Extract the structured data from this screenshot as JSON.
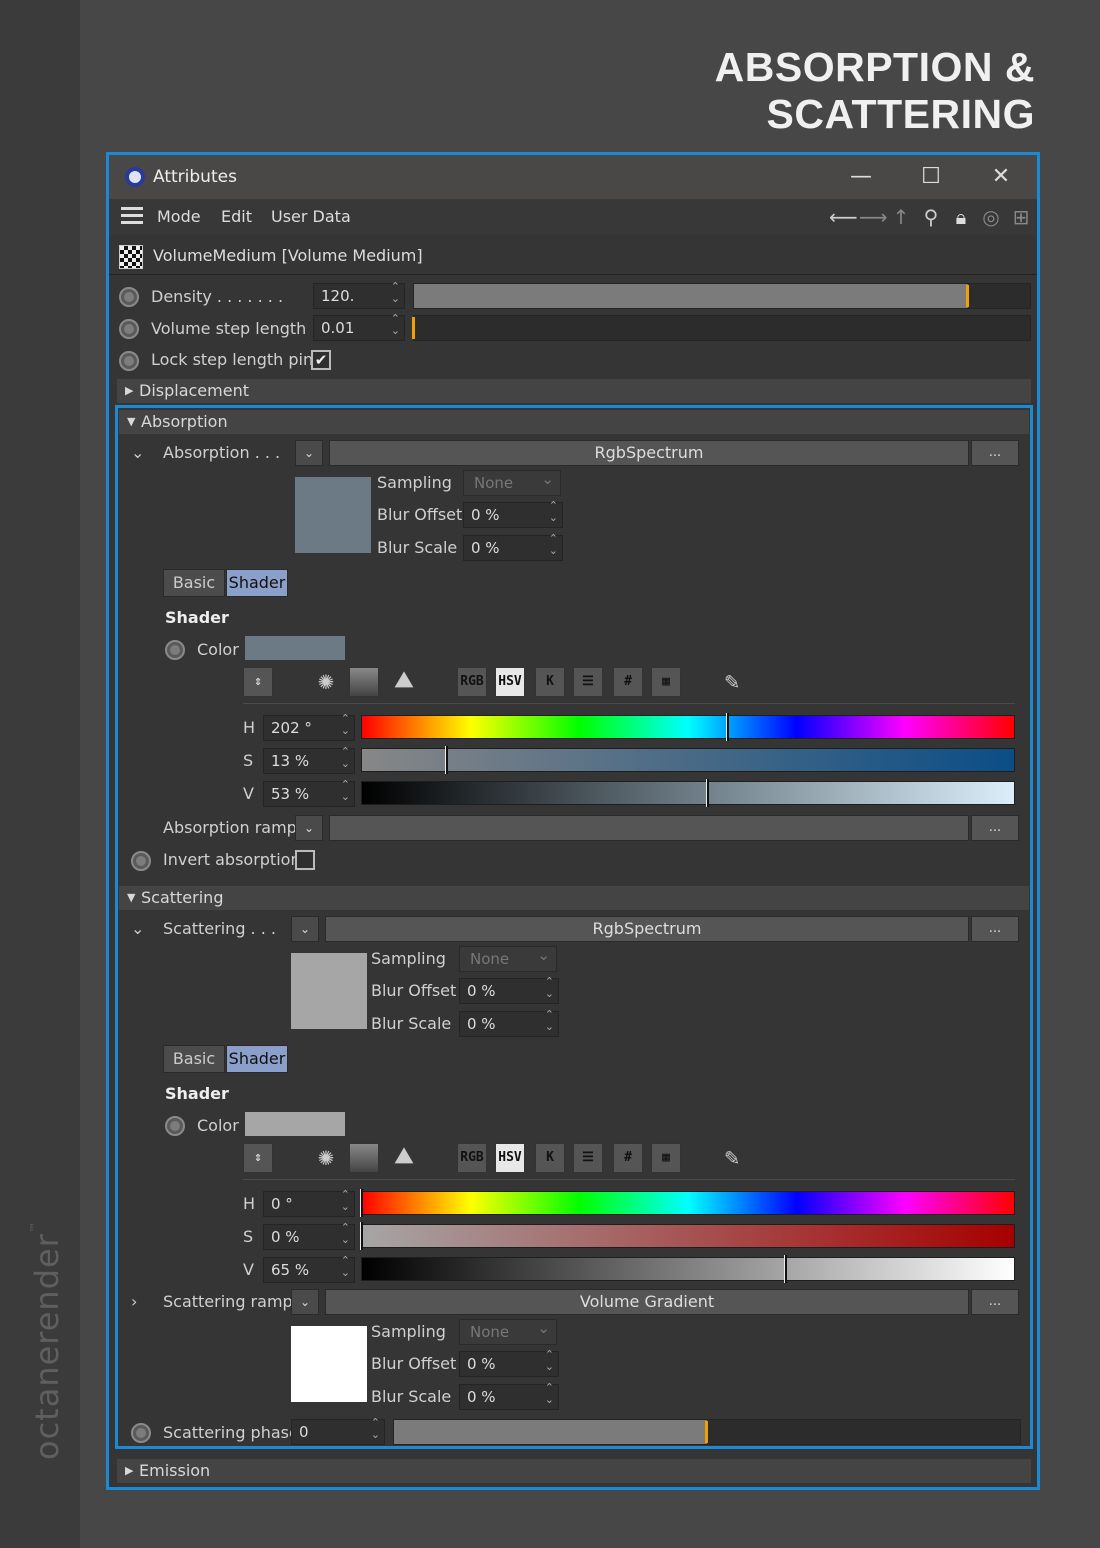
{
  "page_title": "ABSORPTION & SCATTERING",
  "brand": "octanerender",
  "brand_tm": "™",
  "window": {
    "title": "Attributes",
    "min": "—",
    "max": "☐",
    "close": "✕"
  },
  "menu": [
    "Mode",
    "Edit",
    "User Data"
  ],
  "toolbar_icons": [
    "arrow-left-icon",
    "arrow-right-icon",
    "arrow-up-icon",
    "search-icon",
    "lock-icon",
    "target-icon",
    "new-window-icon"
  ],
  "object": {
    "name": "VolumeMedium [Volume Medium]"
  },
  "density": {
    "label": "Density . . . . . . .",
    "value": "120.",
    "fraction": 0.9
  },
  "step": {
    "label": "Volume step length",
    "value": "0.01",
    "fraction": 0.0
  },
  "lock": {
    "label": "Lock step length pins",
    "check": "✔"
  },
  "sections": {
    "displacement": "Displacement",
    "absorption": "Absorption",
    "scattering": "Scattering",
    "emission": "Emission"
  },
  "absorption": {
    "label": "Absorption . . .",
    "dropdown": "⌄",
    "type": "RgbSpectrum",
    "more": "...",
    "swatch": "#6b7a84",
    "sampling_label": "Sampling",
    "sampling_value": "None",
    "blur_offset_label": "Blur Offset",
    "blur_offset_value": "0 %",
    "blur_scale_label": "Blur Scale",
    "blur_scale_value": "0 %",
    "tab_basic": "Basic",
    "tab_shader": "Shader",
    "shader_heading": "Shader",
    "color_label": "Color",
    "h_label": "H",
    "h_value": "202 °",
    "h_pos": 0.561,
    "s_label": "S",
    "s_value": "13 %",
    "s_pos": 0.13,
    "v_label": "V",
    "v_value": "53 %",
    "v_pos": 0.53,
    "ramp_label": "Absorption ramp",
    "invert_label": "Invert absorption"
  },
  "scattering": {
    "label": "Scattering . . .",
    "dropdown": "⌄",
    "type": "RgbSpectrum",
    "more": "...",
    "swatch": "#a6a6a6",
    "sampling_label": "Sampling",
    "sampling_value": "None",
    "blur_offset_label": "Blur Offset",
    "blur_offset_value": "0 %",
    "blur_scale_label": "Blur Scale",
    "blur_scale_value": "0 %",
    "tab_basic": "Basic",
    "tab_shader": "Shader",
    "shader_heading": "Shader",
    "color_label": "Color",
    "h_label": "H",
    "h_value": "0 °",
    "h_pos": 0.0,
    "s_label": "S",
    "s_value": "0 %",
    "s_pos": 0.0,
    "v_label": "V",
    "v_value": "65 %",
    "v_pos": 0.65,
    "ramp_label": "Scattering ramp",
    "ramp_type": "Volume Gradient",
    "ramp_swatch": "#ffffff",
    "ramp_sampling_value": "None",
    "ramp_blur_offset_value": "0 %",
    "ramp_blur_scale_value": "0 %",
    "phase_label": "Scattering phase",
    "phase_value": "0",
    "phase_fraction": 0.5
  },
  "color_tools": [
    "RGB",
    "HSV",
    "K",
    "#"
  ],
  "accent": "#1a8ad6"
}
